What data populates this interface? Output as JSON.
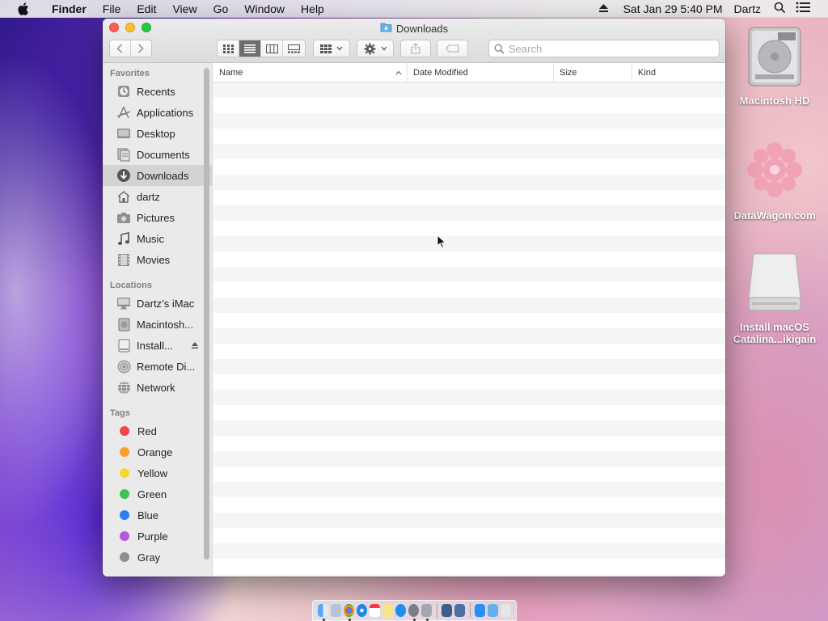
{
  "menubar": {
    "app_name": "Finder",
    "items": [
      "File",
      "Edit",
      "View",
      "Go",
      "Window",
      "Help"
    ],
    "clock": "Sat Jan 29  5:40 PM",
    "user": "Dartz"
  },
  "desktop_icons": [
    {
      "label": "Macintosh HD",
      "icon": "internal-drive-icon"
    },
    {
      "label": "DataWagon.com",
      "icon": "pink-flower-image-icon"
    },
    {
      "label_line1": "Install macOS",
      "label_line2": "Catalina...ikigain",
      "icon": "external-drive-icon"
    }
  ],
  "window": {
    "title": "Downloads",
    "search_placeholder": "Search"
  },
  "sidebar": {
    "favorites_header": "Favorites",
    "favorites": [
      {
        "label": "Recents",
        "icon": "clock-icon"
      },
      {
        "label": "Applications",
        "icon": "applications-icon"
      },
      {
        "label": "Desktop",
        "icon": "desktop-icon"
      },
      {
        "label": "Documents",
        "icon": "documents-icon"
      },
      {
        "label": "Downloads",
        "icon": "downloads-icon",
        "selected": true
      },
      {
        "label": "dartz",
        "icon": "home-icon"
      },
      {
        "label": "Pictures",
        "icon": "camera-icon"
      },
      {
        "label": "Music",
        "icon": "music-note-icon"
      },
      {
        "label": "Movies",
        "icon": "film-icon"
      }
    ],
    "locations_header": "Locations",
    "locations": [
      {
        "label": "Dartz’s iMac",
        "icon": "imac-icon"
      },
      {
        "label": "Macintosh...",
        "icon": "hard-drive-icon"
      },
      {
        "label": "Install...",
        "icon": "drive-icon",
        "eject": true
      },
      {
        "label": "Remote Di...",
        "icon": "disc-icon"
      },
      {
        "label": "Network",
        "icon": "network-globe-icon"
      }
    ],
    "tags_header": "Tags",
    "tags": [
      {
        "label": "Red",
        "color": "#f2464b"
      },
      {
        "label": "Orange",
        "color": "#f7a131"
      },
      {
        "label": "Yellow",
        "color": "#f8d531"
      },
      {
        "label": "Green",
        "color": "#3ec353"
      },
      {
        "label": "Blue",
        "color": "#2f7ff2"
      },
      {
        "label": "Purple",
        "color": "#b25ad8"
      },
      {
        "label": "Gray",
        "color": "#8e8e93"
      }
    ]
  },
  "list": {
    "columns": [
      "Name",
      "Date Modified",
      "Size",
      "Kind"
    ]
  },
  "colors": {
    "accent": "#2f7ff2",
    "selection": "#d3d3d3"
  }
}
